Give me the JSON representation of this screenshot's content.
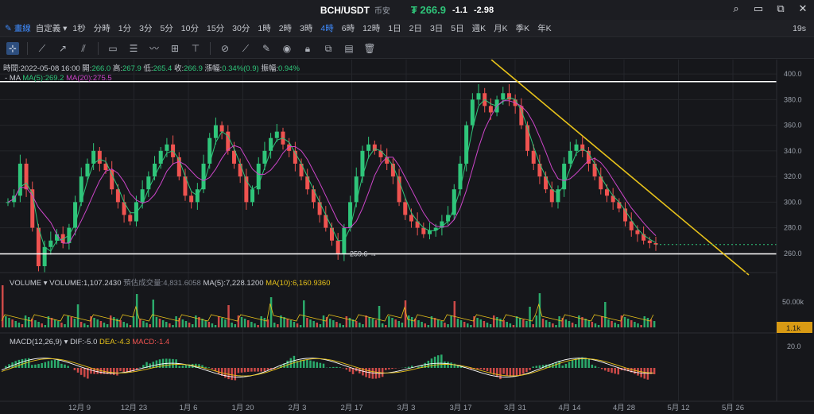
{
  "titlebar": {
    "pair": "BCH/USDT",
    "market_type": "币安",
    "price": "₮ 266.9",
    "change_abs": "-1.1",
    "change_pct": "-2.98"
  },
  "window_buttons": [
    "⌕",
    "▭",
    "⧉",
    "✕"
  ],
  "timeframes": {
    "draw_label": "畫線",
    "custom_label": "自定義",
    "items": [
      "1秒",
      "分時",
      "1分",
      "3分",
      "5分",
      "10分",
      "15分",
      "30分",
      "1時",
      "2時",
      "3時",
      "4時",
      "6時",
      "12時",
      "1日",
      "2日",
      "3日",
      "5日",
      "週K",
      "月K",
      "季K",
      "年K"
    ],
    "active": "4時",
    "countdown": "19s"
  },
  "info": {
    "time_label": "時間:",
    "time": "2022-05-08 16:00",
    "open_label": "開:",
    "open": "266.0",
    "high_label": "高:",
    "high": "267.9",
    "low_label": "低:",
    "low": "265.4",
    "close_label": "收:",
    "close": "266.9",
    "change_label": "漲幅:",
    "change": "0.34%(0.9)",
    "amp_label": "振幅:",
    "amp": "0.94%"
  },
  "ma": {
    "label": "MA",
    "ma5": "MA(5):269.2",
    "ma20": "MA(20):275.5"
  },
  "volume": {
    "label": "VOLUME",
    "value": "VOLUME:1,107.2430",
    "estimate": "預估成交量:4,831.6058",
    "ma5": "MA(5):7,228.1200",
    "ma10": "MA(10):6,160.9360",
    "axis_top": "50.00k",
    "current_badge": "1.1k"
  },
  "macd": {
    "label": "MACD(12,26,9)",
    "dif": "DIF:-5.0",
    "dea": "DEA:-4.3",
    "macd": "MACD:-1.4",
    "axis_top": "20.0"
  },
  "price_axis": [
    "400.0",
    "380.0",
    "360.0",
    "340.0",
    "320.0",
    "300.0",
    "280.0",
    "260.0"
  ],
  "current_price_badge": "266.9",
  "low_marker": "259.6",
  "x_axis": [
    "12月 9",
    "12月 23",
    "1月 6",
    "1月 20",
    "2月 3",
    "2月 17",
    "3月 3",
    "3月 17",
    "3月 31",
    "4月 14",
    "4月 28",
    "5月 12",
    "5月 26"
  ],
  "colors": {
    "up": "#2fc57a",
    "down": "#ef5350",
    "ma5": "#2fc57a",
    "ma20": "#cc45c8",
    "trendline": "#e7c21a",
    "hline": "#ffffff",
    "volma10": "#e7c21a",
    "accent": "#3f8cff"
  },
  "chart_data": {
    "type": "candlestick",
    "price_range": [
      250,
      405
    ],
    "horizontal_lines": [
      394,
      259.6
    ],
    "trendline": {
      "from": [
        "2022-03-27",
        408
      ],
      "to": [
        "2022-05-25",
        248
      ]
    },
    "close_series": [
      300,
      305,
      330,
      310,
      280,
      250,
      265,
      270,
      275,
      268,
      280,
      300,
      320,
      330,
      340,
      330,
      325,
      310,
      300,
      290,
      285,
      300,
      310,
      320,
      330,
      340,
      345,
      335,
      320,
      305,
      300,
      310,
      330,
      350,
      360,
      355,
      340,
      330,
      320,
      300,
      310,
      330,
      340,
      350,
      355,
      345,
      340,
      330,
      320,
      310,
      300,
      290,
      280,
      270,
      260,
      280,
      300,
      320,
      340,
      345,
      340,
      335,
      330,
      320,
      300,
      290,
      285,
      280,
      275,
      278,
      280,
      285,
      290,
      310,
      330,
      360,
      380,
      385,
      375,
      370,
      380,
      385,
      380,
      375,
      360,
      340,
      330,
      320,
      310,
      300,
      310,
      330,
      340,
      345,
      340,
      330,
      320,
      310,
      305,
      300,
      295,
      285,
      278,
      275,
      270,
      268,
      266.9
    ]
  }
}
